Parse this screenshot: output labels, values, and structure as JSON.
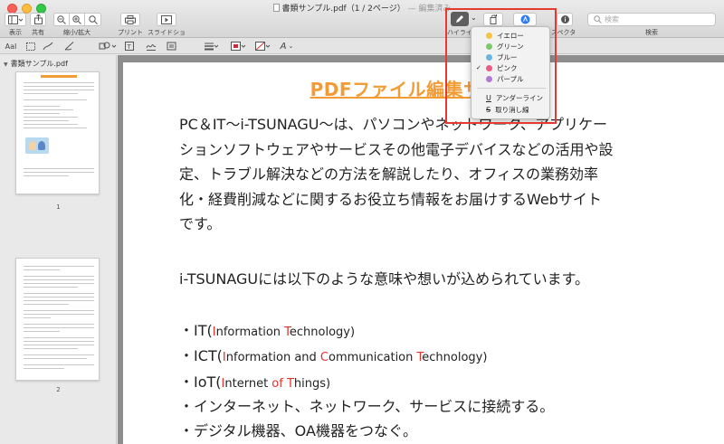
{
  "window": {
    "title": "書類サンプル.pdf（1 / 2ページ）",
    "edited": "— 編集済み"
  },
  "toolbar": {
    "view_label": "表示",
    "share_label": "共有",
    "zoom_label": "縮小/拡大",
    "print_label": "プリント",
    "slideshow_label": "スライドショー",
    "highlight_label": "ハイライ",
    "inspector_label": "スペクタ",
    "search_label": "検索",
    "search_placeholder": "検索"
  },
  "highlight_menu": {
    "items": [
      {
        "label": "イエロー",
        "color": "#f6c343"
      },
      {
        "label": "グリーン",
        "color": "#7ec96b"
      },
      {
        "label": "ブルー",
        "color": "#68b3e8"
      },
      {
        "label": "ピンク",
        "color": "#ea5b87"
      },
      {
        "label": "パープル",
        "color": "#b07ad3"
      }
    ],
    "selected": "ピンク",
    "underline_label": "アンダーライン",
    "strike_label": "取り消し線"
  },
  "sidebar": {
    "file_name": "書類サンプル.pdf",
    "page1_num": "1",
    "page2_num": "2"
  },
  "document": {
    "title": "PDFファイル編集サンプル",
    "para1_lines": [
      "PC＆IT〜i-TSUNAGU〜は、パソコンやネットワーク、アプリケー",
      "ションソフトウェアやサービスその他電子デバイスなどの活用や設",
      "定、トラブル解決などの方法を解説したり、オフィスの業務効率",
      "化・経費削減などに関するお役立ち情報をお届けするWebサイト",
      "です。"
    ],
    "para2": "i-TSUNAGUには以下のような意味や想いが込められています。",
    "bullets": [
      {
        "prefix": "・IT(",
        "parts": [
          [
            "I",
            "r"
          ],
          [
            "nformation ",
            ""
          ],
          [
            "T",
            "r"
          ],
          [
            "echnology)",
            ""
          ]
        ]
      },
      {
        "prefix": "・ICT(",
        "parts": [
          [
            "I",
            "r"
          ],
          [
            "nformation and ",
            ""
          ],
          [
            "C",
            "r"
          ],
          [
            "ommunication ",
            ""
          ],
          [
            "T",
            "r"
          ],
          [
            "echnology)",
            ""
          ]
        ]
      },
      {
        "prefix": "・IoT(",
        "parts": [
          [
            "I",
            "r"
          ],
          [
            "nternet ",
            ""
          ],
          [
            "of",
            "r"
          ],
          [
            " ",
            ""
          ],
          [
            "T",
            "r"
          ],
          [
            "hings)",
            ""
          ]
        ]
      }
    ],
    "bullet4": "・インターネット、ネットワーク、サービスに接続する。",
    "bullet5": "・デジタル機器、OA機器をつなぐ。"
  }
}
